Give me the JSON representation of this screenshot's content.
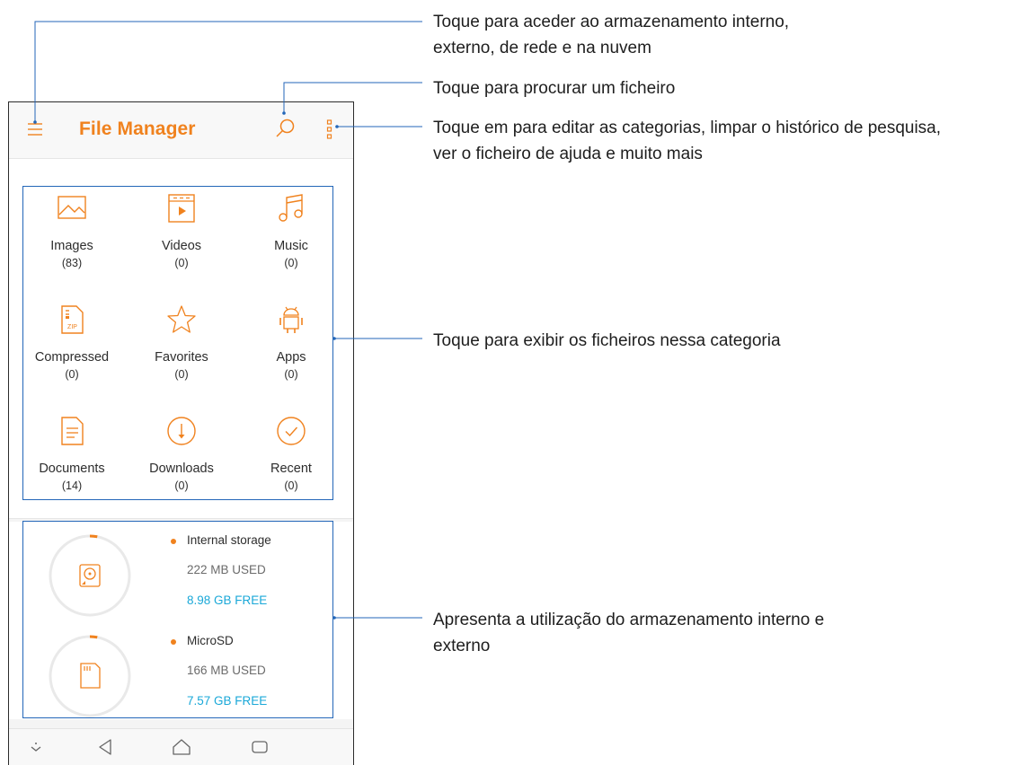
{
  "app": {
    "title": "File Manager"
  },
  "toolbar": {
    "menu_icon": "hamburger-menu-icon",
    "search_icon": "search-icon",
    "more_icon": "more-options-icon"
  },
  "categories": [
    {
      "label": "Images",
      "count": "(83)",
      "icon": "image-icon"
    },
    {
      "label": "Videos",
      "count": "(0)",
      "icon": "video-icon"
    },
    {
      "label": "Music",
      "count": "(0)",
      "icon": "music-note-icon"
    },
    {
      "label": "Compressed",
      "count": "(0)",
      "icon": "zip-file-icon"
    },
    {
      "label": "Favorites",
      "count": "(0)",
      "icon": "star-icon"
    },
    {
      "label": "Apps",
      "count": "(0)",
      "icon": "android-icon"
    },
    {
      "label": "Documents",
      "count": "(14)",
      "icon": "document-icon"
    },
    {
      "label": "Downloads",
      "count": "(0)",
      "icon": "download-icon"
    },
    {
      "label": "Recent",
      "count": "(0)",
      "icon": "check-circle-icon"
    }
  ],
  "storage": [
    {
      "name": "Internal storage",
      "used": "222 MB USED",
      "free": "8.98 GB FREE",
      "used_fraction": 0.03,
      "icon": "hard-disk-icon"
    },
    {
      "name": "MicroSD",
      "used": "166 MB USED",
      "free": "7.57 GB FREE",
      "used_fraction": 0.03,
      "icon": "sd-card-icon"
    }
  ],
  "navbar": {
    "icons": [
      "chevron-down-icon",
      "back-icon",
      "home-icon",
      "recent-apps-icon"
    ]
  },
  "callouts": {
    "drawer": "Toque para aceder ao armazenamento interno,\nexterno, de rede e na nuvem",
    "search": "Toque para procurar um ficheiro",
    "more": "Toque em para editar as categorias, limpar o histórico de pesquisa,\nver o ficheiro de ajuda e muito mais",
    "categories": "Toque para exibir os ficheiros nessa categoria",
    "storage": "Apresenta a utilização do armazenamento interno e\nexterno"
  },
  "colors": {
    "accent": "#f0821e",
    "free_text": "#1aa8d8",
    "callout_line": "#2366b8"
  }
}
